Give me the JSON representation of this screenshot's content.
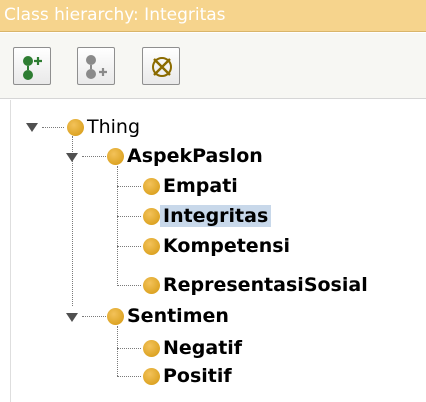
{
  "window": {
    "title": "Class hierarchy: Integritas"
  },
  "toolbar": {
    "buttons": [
      {
        "icon": "add-subclass-icon"
      },
      {
        "icon": "add-sibling-class-icon"
      },
      {
        "icon": "delete-class-icon"
      }
    ]
  },
  "tree": {
    "root": {
      "label": "Thing",
      "expanded": true
    },
    "aspek": {
      "label": "AspekPaslon",
      "expanded": true
    },
    "empati": {
      "label": "Empati"
    },
    "integritas": {
      "label": "Integritas",
      "selected": true
    },
    "kompetensi": {
      "label": "Kompetensi"
    },
    "representasi": {
      "label": "RepresentasiSosial"
    },
    "sentimen": {
      "label": "Sentimen",
      "expanded": true
    },
    "negatif": {
      "label": "Negatif"
    },
    "positif": {
      "label": "Positif"
    }
  },
  "colors": {
    "title_bar": "#f6d48d",
    "class_dot": "#e1a82a",
    "selection": "#c8d8ea"
  }
}
